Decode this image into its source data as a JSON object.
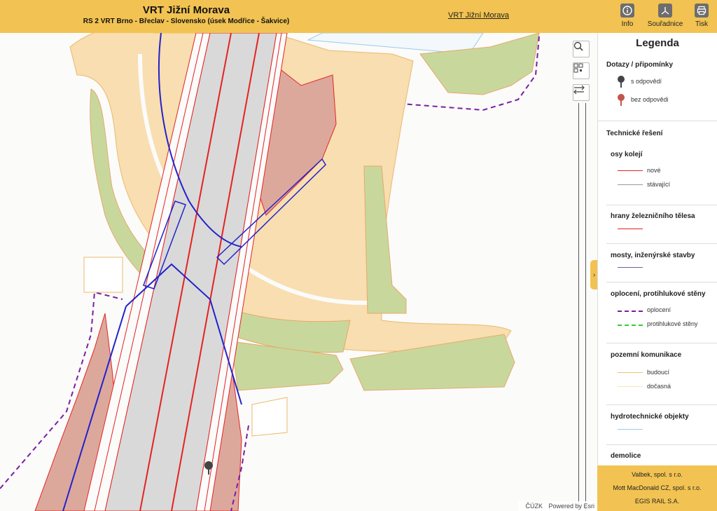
{
  "header": {
    "title": "VRT Jižní Morava",
    "subtitle": "RS 2 VRT Brno - Břeclav - Slovensko (úsek Modřice - Šakvice)",
    "link": "VRT Jižní Morava",
    "buttons": {
      "info": "Info",
      "coords": "Souřadnice",
      "print": "Tisk"
    },
    "color": "#f2c352"
  },
  "map": {
    "attribution": {
      "cuzk": "ČÚZK",
      "esri": "Powered by Esri"
    },
    "icons": [
      "search-icon",
      "qr-code-icon",
      "measure-icon"
    ],
    "colors": {
      "track_new": "#e52222",
      "road": "#f8deb0",
      "vegetation": "#c8d89c",
      "embankment": "#dda89c",
      "fence": "#7a1fa2",
      "bridge": "#2222cc"
    }
  },
  "legend": {
    "title": "Legenda",
    "comments": {
      "heading": "Dotazy / připomínky",
      "answered": "s odpovědí",
      "unanswered": "bez odpovědi"
    },
    "technical": {
      "heading": "Technické řešení",
      "groups": [
        {
          "title": "osy kolejí",
          "items": [
            {
              "label": "nové",
              "color": "#e52222"
            },
            {
              "label": "stávající",
              "color": "#999999"
            }
          ]
        },
        {
          "title": "hrany železničního tělesa",
          "items": [
            {
              "label": "",
              "color": "#e52222"
            }
          ]
        },
        {
          "title": "mosty, inženýrské stavby",
          "items": [
            {
              "label": "",
              "color": "#7a5aa0"
            }
          ]
        },
        {
          "title": "oplocení, protihlukové stěny",
          "items": [
            {
              "label": "oplocení",
              "color": "#7a1fa2"
            },
            {
              "label": "protihlukové stěny",
              "color": "#33cc33"
            }
          ]
        },
        {
          "title": "pozemní komunikace",
          "items": [
            {
              "label": "budoucí",
              "color": "#f0c070"
            },
            {
              "label": "dočasná",
              "color": "#f8e3b8"
            }
          ]
        },
        {
          "title": "hydrotechnické objekty",
          "items": [
            {
              "label": "",
              "color": "#9ecae8"
            }
          ]
        },
        {
          "title": "demolice",
          "items": []
        }
      ]
    }
  },
  "footer": {
    "companies": [
      "Valbek, spol. s r.o.",
      "Mott MacDonald CZ, spol. s r.o.",
      "EGIS RAIL S.A."
    ]
  }
}
